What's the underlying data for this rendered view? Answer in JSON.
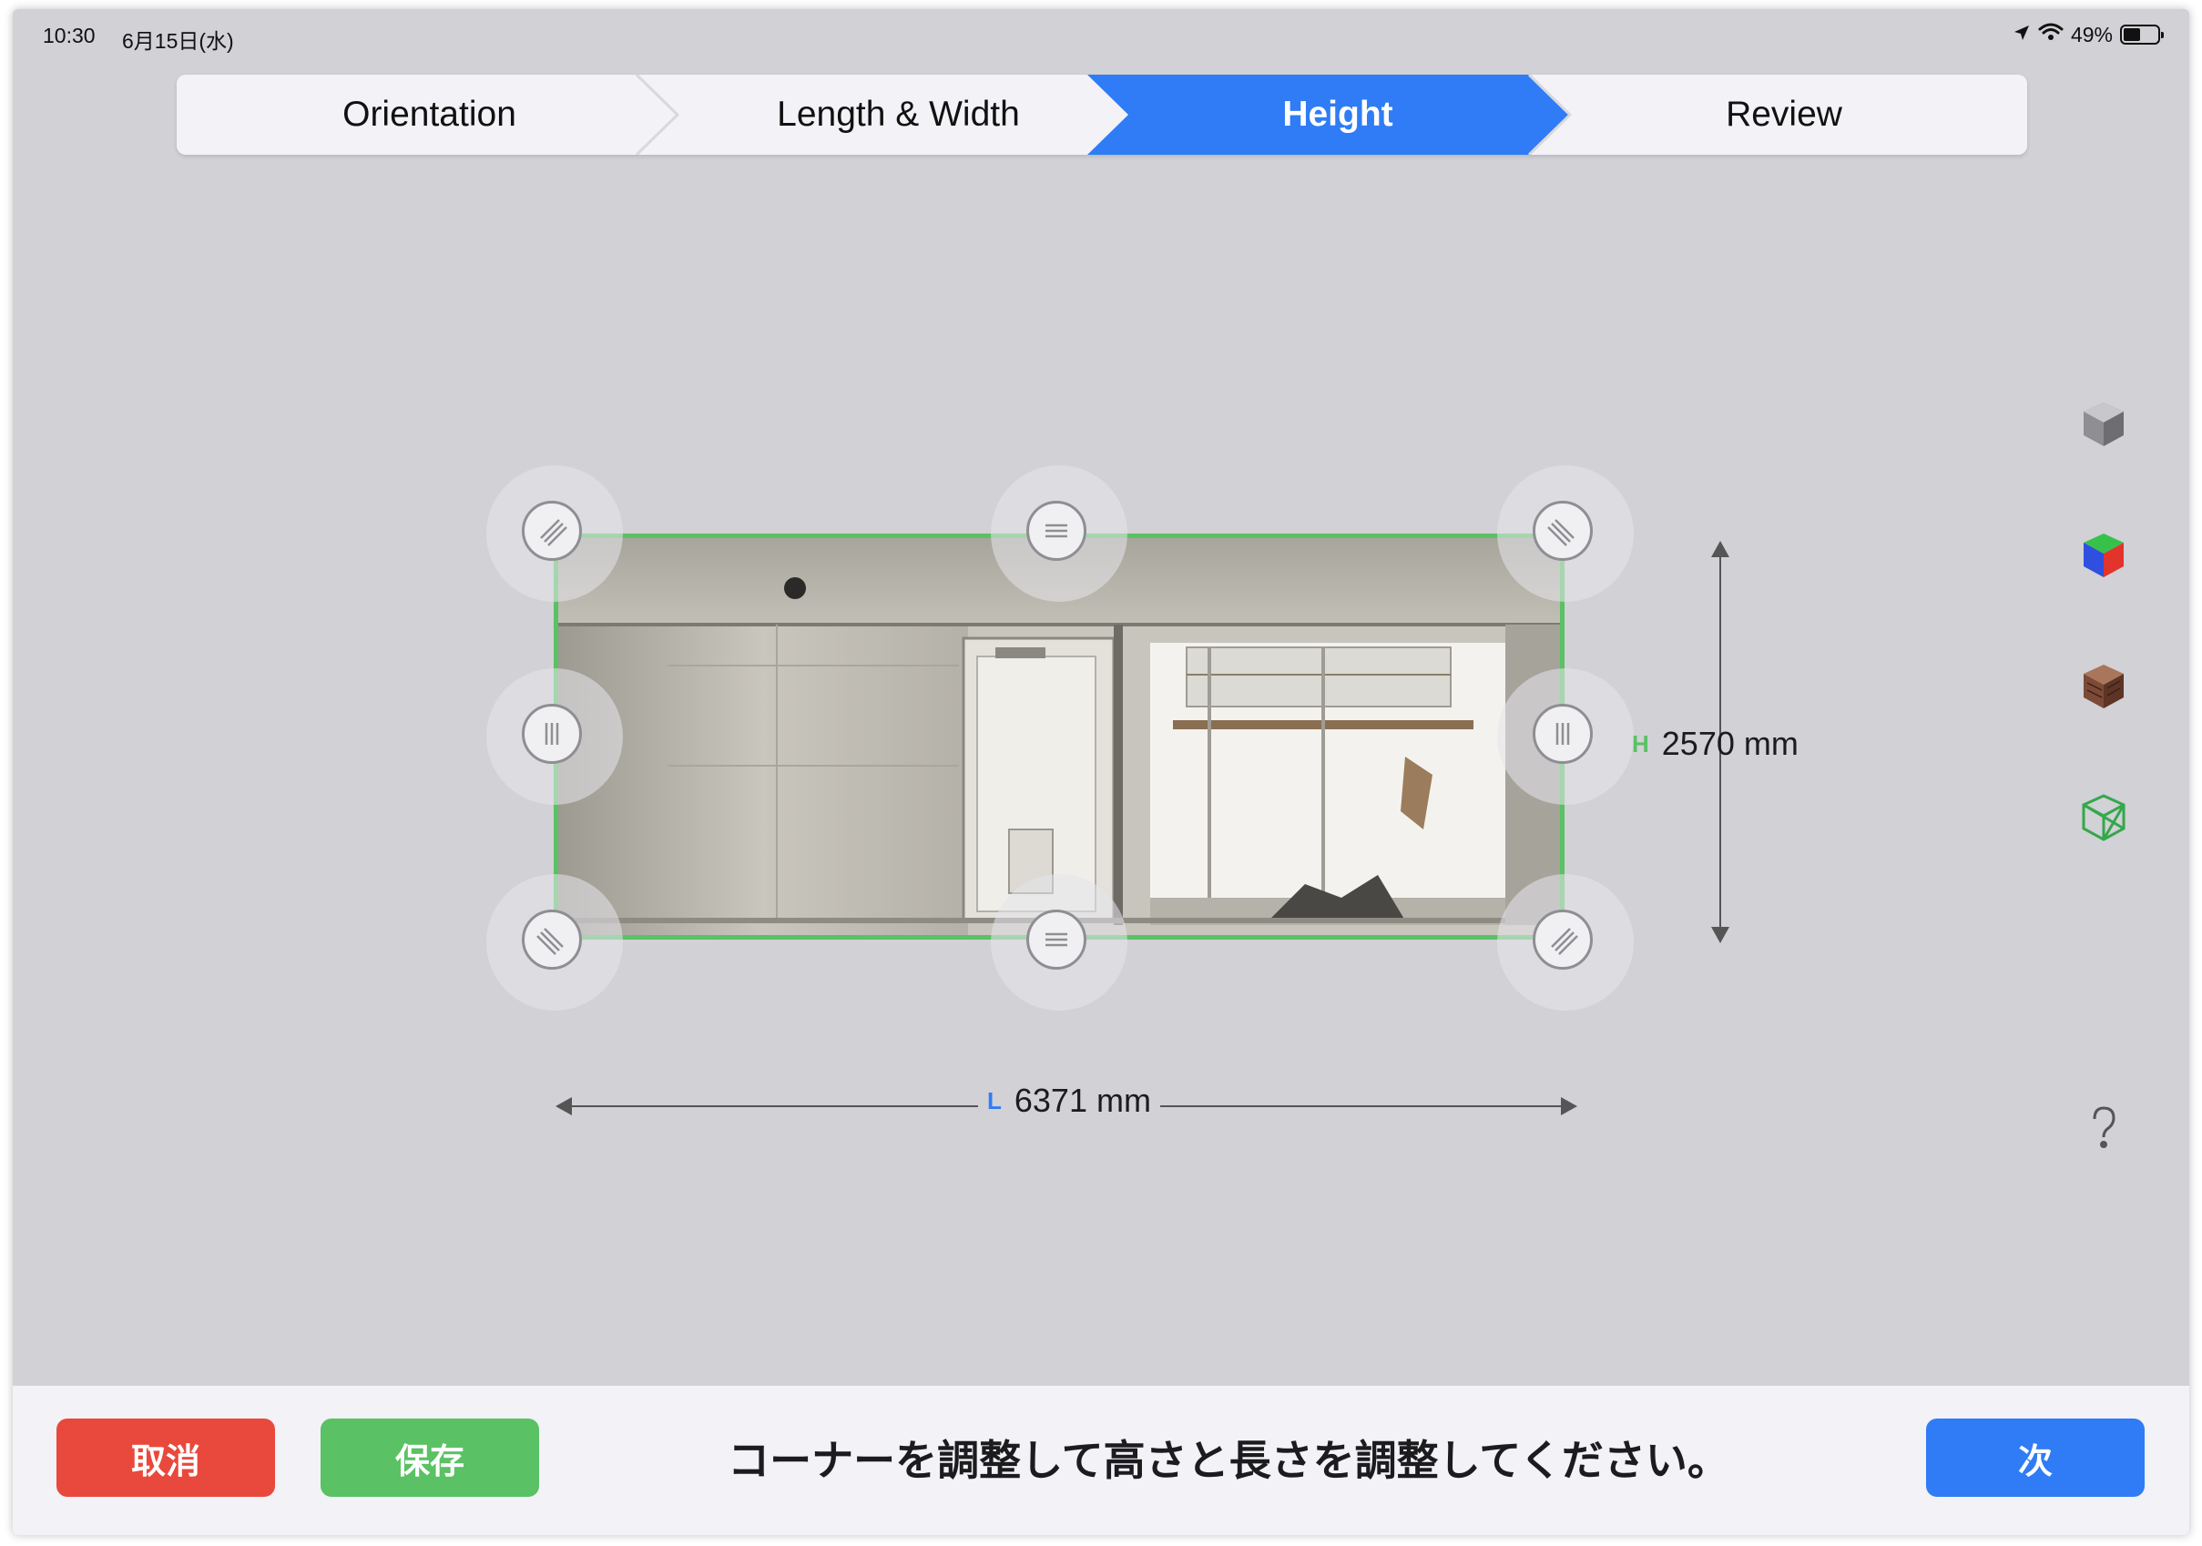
{
  "status_bar": {
    "time": "10:30",
    "date": "6月15日(水)",
    "battery": "49%",
    "battery_level": 0.49
  },
  "steps": [
    {
      "label": "Orientation",
      "active": false
    },
    {
      "label": "Length & Width",
      "active": false
    },
    {
      "label": "Height",
      "active": true
    },
    {
      "label": "Review",
      "active": false
    }
  ],
  "measurements": {
    "height_tag": "H",
    "height_value": "2570 mm",
    "length_tag": "L",
    "length_value": "6371 mm"
  },
  "tools": [
    {
      "icon": "gray-cube-icon"
    },
    {
      "icon": "color-cube-icon"
    },
    {
      "icon": "texture-cube-icon"
    },
    {
      "icon": "wireframe-cube-icon"
    },
    {
      "icon": "help-icon"
    }
  ],
  "bottom_bar": {
    "cancel_label": "取消",
    "save_label": "保存",
    "instruction": "コーナーを調整して高さと長さを調整してください。",
    "next_label": "次"
  },
  "colors": {
    "active_step": "#2f7cf6",
    "cancel": "#e9493c",
    "save": "#5ac164",
    "next": "#2f7cf6",
    "frame": "#5ac164"
  }
}
